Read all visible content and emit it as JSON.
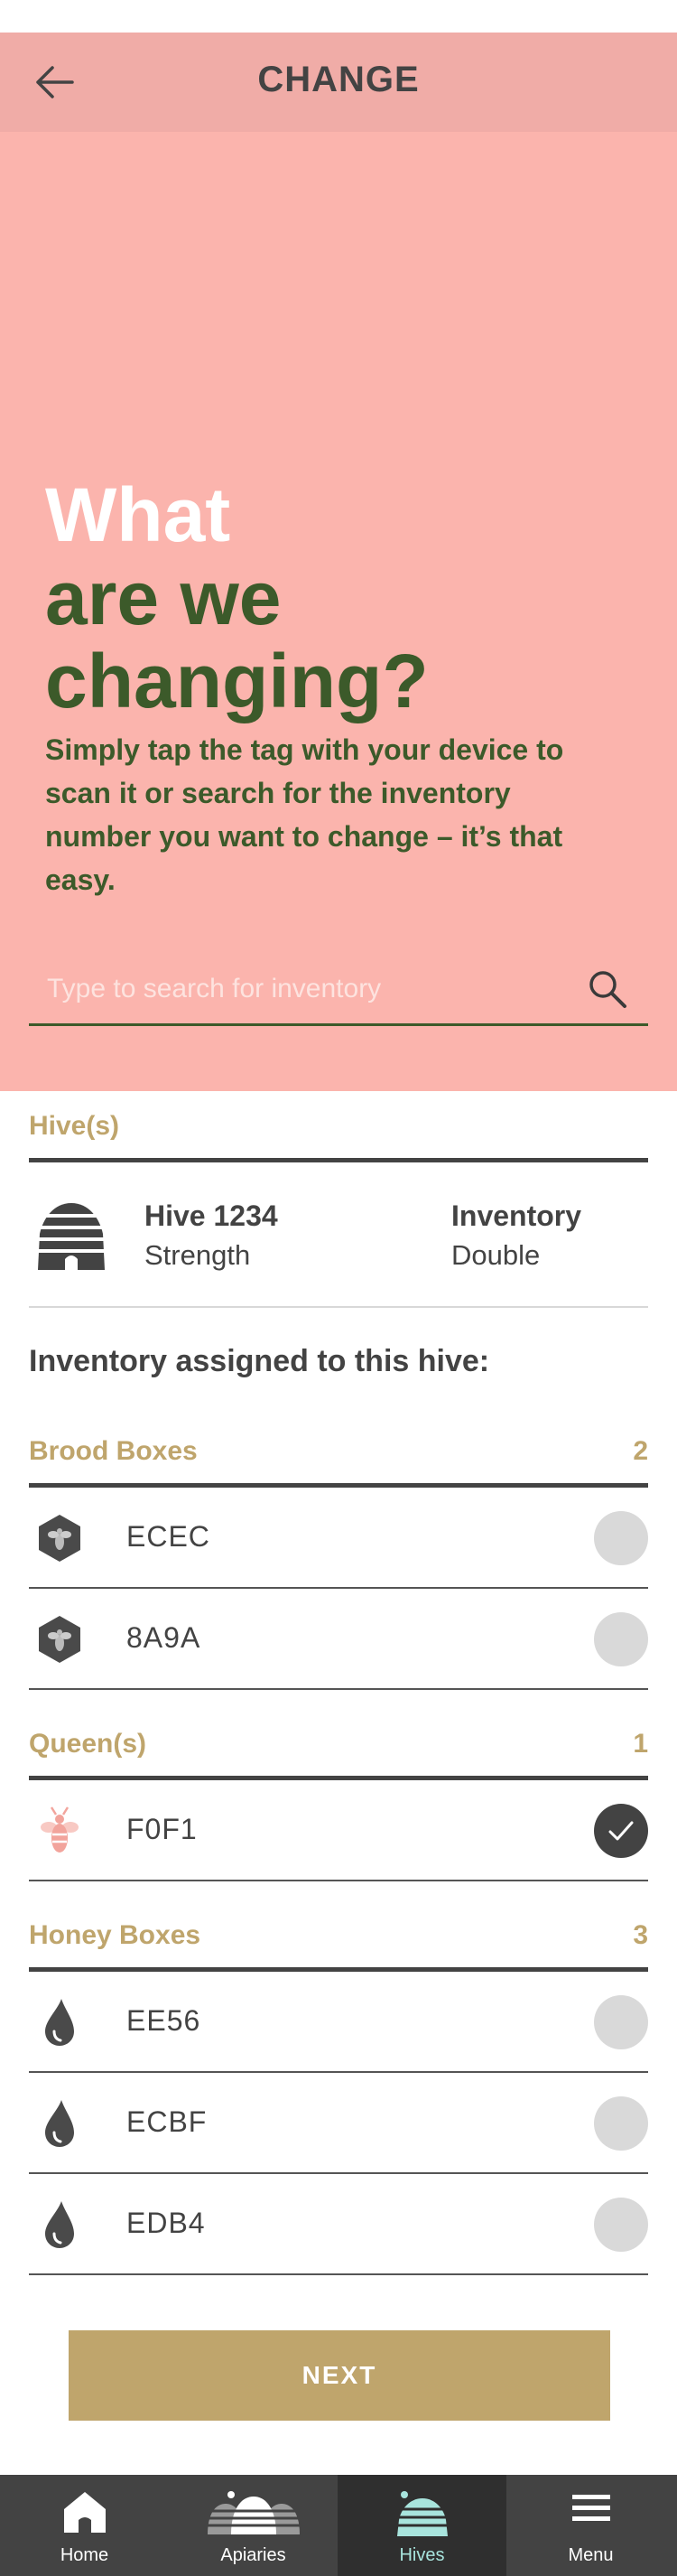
{
  "header": {
    "title": "CHANGE"
  },
  "hero": {
    "title_line1": "What",
    "title_line2": "are we",
    "title_line3": "changing?",
    "subtitle": "Simply tap the tag with your device to scan it or search for the inventory number you want to change – it’s that easy."
  },
  "search": {
    "placeholder": "Type to search for inventory",
    "value": ""
  },
  "hives": {
    "label": "Hive(s)",
    "item": {
      "name": "Hive 1234",
      "strength": "Strength",
      "inventory_label": "Inventory",
      "inventory_value": "Double"
    }
  },
  "assigned_heading": "Inventory assigned to this hive:",
  "groups": [
    {
      "label": "Brood Boxes",
      "count": "2",
      "icon": "bee-hexagon-icon",
      "items": [
        {
          "code": "ECEC",
          "selected": false
        },
        {
          "code": "8A9A",
          "selected": false
        }
      ]
    },
    {
      "label": "Queen(s)",
      "count": "1",
      "icon": "queen-bee-icon",
      "items": [
        {
          "code": "F0F1",
          "selected": true
        }
      ]
    },
    {
      "label": "Honey Boxes",
      "count": "3",
      "icon": "honey-drop-icon",
      "items": [
        {
          "code": "EE56",
          "selected": false
        },
        {
          "code": "ECBF",
          "selected": false
        },
        {
          "code": "EDB4",
          "selected": false
        }
      ]
    }
  ],
  "next_label": "NEXT",
  "tabbar": {
    "tabs": [
      {
        "label": "Home",
        "icon": "home-icon",
        "active": false
      },
      {
        "label": "Apiaries",
        "icon": "apiaries-icon",
        "active": false
      },
      {
        "label": "Hives",
        "icon": "hive-icon",
        "active": true
      },
      {
        "label": "Menu",
        "icon": "menu-icon",
        "active": false
      }
    ]
  },
  "colors": {
    "header_bg": "#f0aca7",
    "hero_bg": "#fbb4ad",
    "green": "#3c5a2a",
    "gold": "#bfa56c",
    "dark": "#434343",
    "active_tab": "#a8e4dd"
  }
}
